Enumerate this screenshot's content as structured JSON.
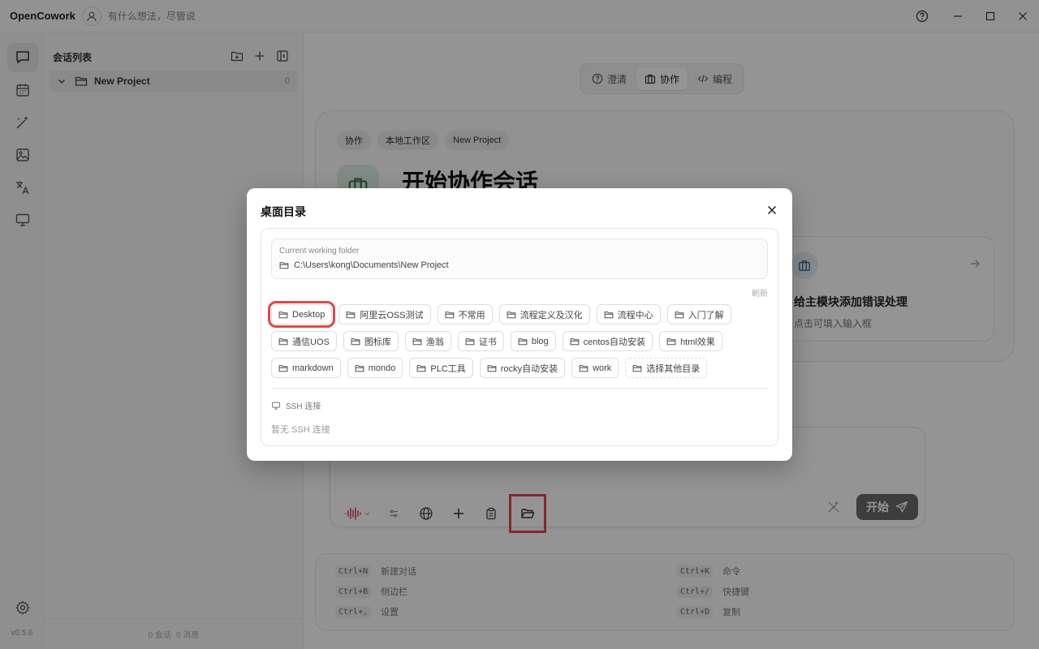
{
  "app": {
    "name": "OpenCowork",
    "status_text": "有什么想法，尽管说"
  },
  "rail": {
    "version": "v0.5.6"
  },
  "sidebar": {
    "title": "会话列表",
    "project": {
      "name": "New Project",
      "count": "0"
    },
    "footer": {
      "sessions": "0 会话",
      "messages": "0 消息"
    }
  },
  "mode_tabs": [
    {
      "label": "澄清"
    },
    {
      "label": "协作"
    },
    {
      "label": "编程"
    }
  ],
  "hero": {
    "chips": [
      "协作",
      "本地工作区",
      "New Project"
    ],
    "title": "开始协作会话",
    "suggestion": {
      "title": "给主模块添加错误处理",
      "subtitle": "点击可填入输入框"
    }
  },
  "composer": {
    "start_label": "开始"
  },
  "shortcuts": [
    {
      "key": "Ctrl+N",
      "label": "新建对话"
    },
    {
      "key": "Ctrl+B",
      "label": "侧边栏"
    },
    {
      "key": "Ctrl+,",
      "label": "设置"
    },
    {
      "key": "Ctrl+K",
      "label": "命令"
    },
    {
      "key": "Ctrl+/",
      "label": "快捷键"
    },
    {
      "key": "Ctrl+D",
      "label": "复制"
    }
  ],
  "modal": {
    "title": "桌面目录",
    "current_folder_label": "Current working folder",
    "current_folder_path": "C:\\Users\\kong\\Documents\\New Project",
    "refresh_label": "刷新",
    "folders": [
      "Desktop",
      "阿里云OSS测试",
      "不常用",
      "流程定义及汉化",
      "流程中心",
      "入门了解",
      "通信UOS",
      "图标库",
      "渔翁",
      "证书",
      "blog",
      "centos自动安装",
      "html效果",
      "markdown",
      "mondo",
      "PLC工具",
      "rocky自动安装",
      "work"
    ],
    "choose_other": "选择其他目录",
    "ssh_title": "SSH 连接",
    "ssh_empty": "暂无 SSH 连接"
  },
  "colors": {
    "highlight": "#e04848",
    "voice": "#d94a5a"
  }
}
